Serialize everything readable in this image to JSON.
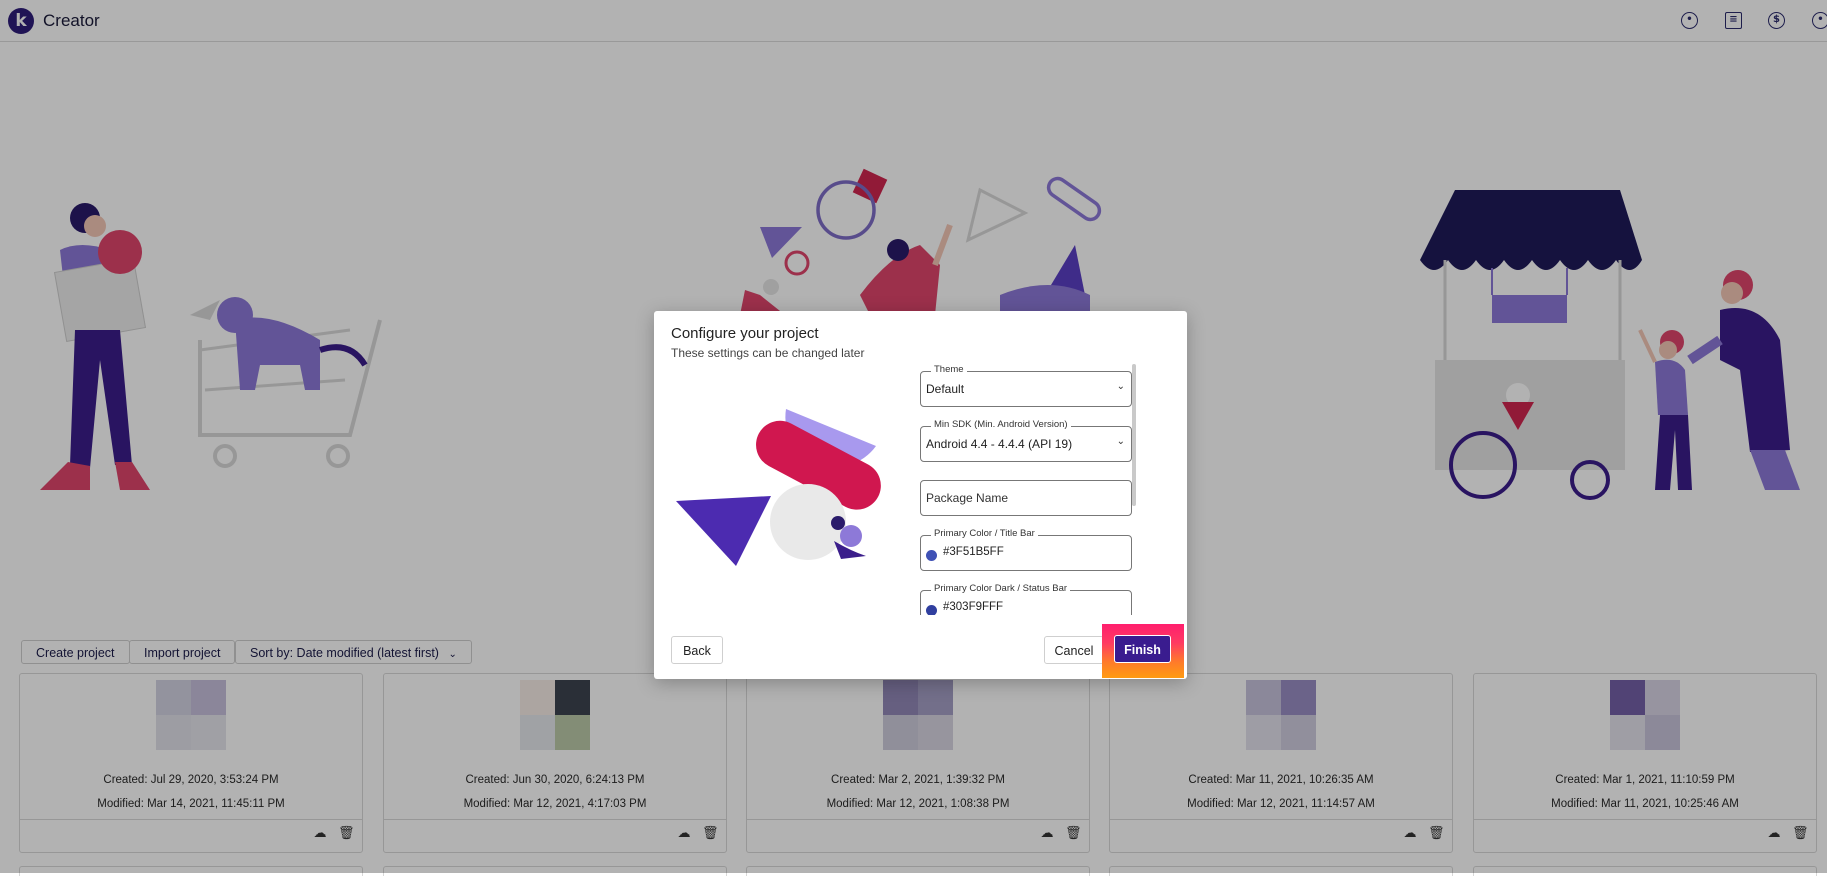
{
  "app": {
    "title": "Creator",
    "logo_letter": "k"
  },
  "header_icons": [
    "palette-icon",
    "docs-icon",
    "dollar-icon",
    "account-icon"
  ],
  "toolbar": {
    "create_label": "Create project",
    "import_label": "Import project",
    "sort_label": "Sort by: Date modified (latest first)"
  },
  "projects": [
    {
      "created": "Created: Jul 29, 2020, 3:53:24 PM",
      "modified": "Modified: Mar 14, 2021, 11:45:11 PM",
      "colors": [
        "#d3d3e3",
        "#c7c0dd",
        "#e1e1ea",
        "#e6e6ec"
      ]
    },
    {
      "created": "Created: Jun 30, 2020, 6:24:13 PM",
      "modified": "Modified: Mar 12, 2021, 4:17:03 PM",
      "colors": [
        "#f6ece7",
        "#3d4450",
        "#e6e8ec",
        "#bccaa9"
      ]
    },
    {
      "created": "Created: Mar 2, 2021, 1:39:32 PM",
      "modified": "Modified: Mar 12, 2021, 1:08:38 PM",
      "colors": [
        "#9289b8",
        "#a59fc6",
        "#cfcddd",
        "#d8d6e2"
      ]
    },
    {
      "created": "Created: Mar 11, 2021, 10:26:35 AM",
      "modified": "Modified: Mar 12, 2021, 11:14:57 AM",
      "colors": [
        "#c7c3dd",
        "#9a8fc5",
        "#e3e1ec",
        "#d0cde0"
      ]
    },
    {
      "created": "Created: Mar 1, 2021, 11:10:59 PM",
      "modified": "Modified: Mar 11, 2021, 10:25:46 AM",
      "colors": [
        "#7461a8",
        "#d8d5e6",
        "#e4e2ec",
        "#c9c4dc"
      ]
    }
  ],
  "dialog": {
    "title": "Configure your project",
    "subtitle": "These settings can be changed later",
    "fields": {
      "theme": {
        "label": "Theme",
        "value": "Default"
      },
      "min_sdk": {
        "label": "Min SDK (Min. Android Version)",
        "value": "Android 4.4 - 4.4.4 (API 19)"
      },
      "package": {
        "placeholder": "Package Name"
      },
      "primary": {
        "label": "Primary Color / Title Bar",
        "value": "#3F51B5FF",
        "color": "#3F51B5"
      },
      "primary_dark": {
        "label": "Primary Color Dark / Status Bar",
        "value": "#303F9FFF",
        "color": "#303F9F"
      }
    },
    "back_label": "Back",
    "cancel_label": "Cancel",
    "finish_label": "Finish"
  }
}
